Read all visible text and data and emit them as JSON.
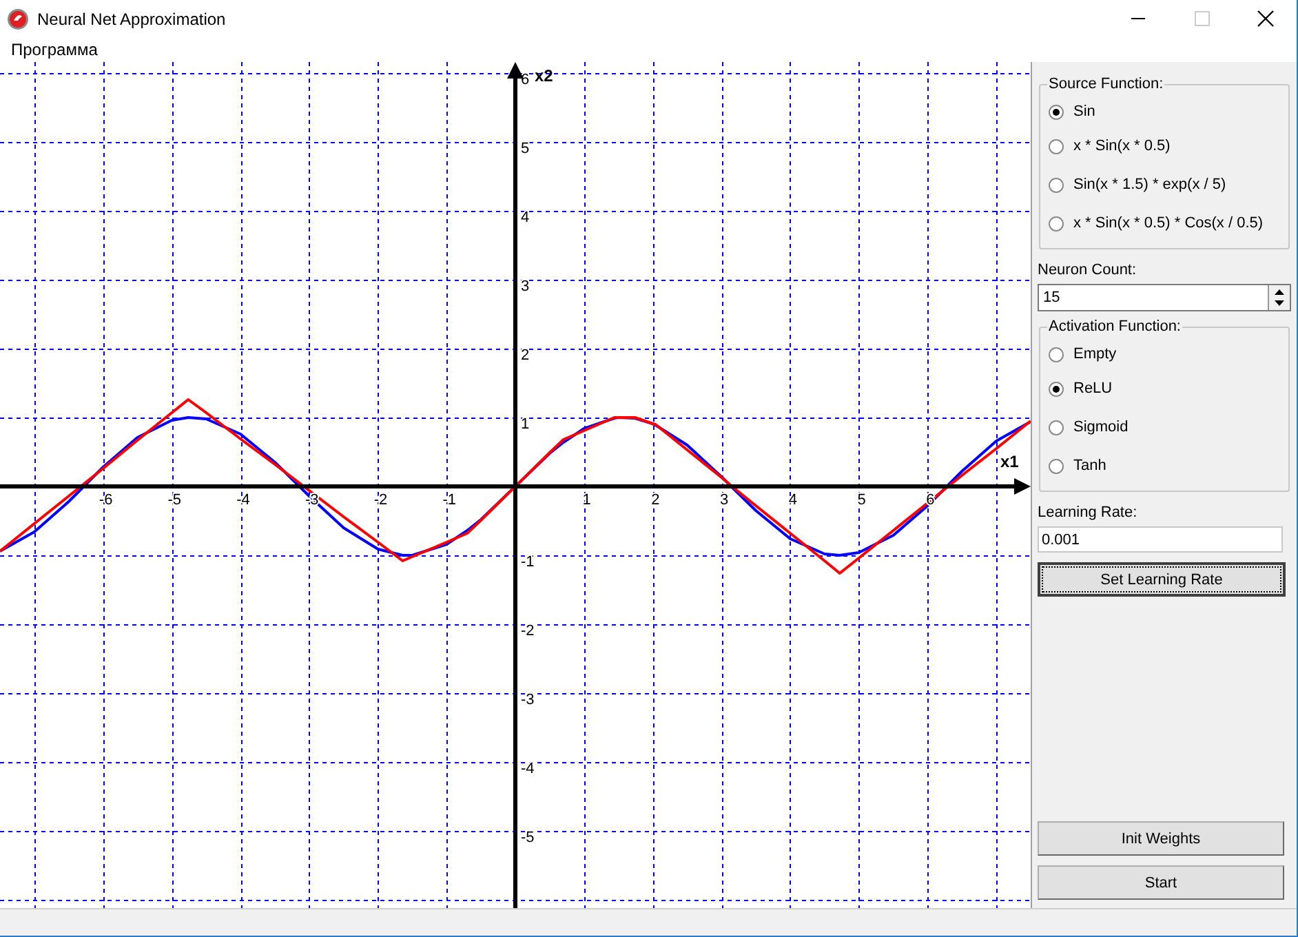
{
  "window": {
    "title": "Neural Net Approximation"
  },
  "menu": [
    {
      "label": "Программа"
    }
  ],
  "plot": {
    "chart_data": {
      "type": "line",
      "xlabel": "x1",
      "ylabel": "x2",
      "grid": true,
      "xlim": [
        -7.5,
        7.5
      ],
      "ylim": [
        -6.14,
        6.16
      ],
      "xticks": [
        -6,
        -5,
        -4,
        -3,
        -2,
        -1,
        1,
        2,
        3,
        4,
        5,
        6
      ],
      "yticks": [
        -5,
        -4,
        -3,
        -2,
        -1,
        1,
        2,
        3,
        4,
        5,
        6
      ],
      "x": [
        -7.5,
        -7,
        -6.5,
        -6,
        -5.5,
        -5,
        -4.76,
        -4.5,
        -4,
        -3.5,
        -3,
        -2.5,
        -2,
        -1.64,
        -1.5,
        -1,
        -0.7,
        -0.5,
        0,
        0.5,
        0.7,
        1,
        1.44,
        1.5,
        1.74,
        2,
        2.04,
        2.5,
        3,
        3.14,
        3.5,
        4,
        4.5,
        4.72,
        5,
        5.5,
        6,
        6.5,
        7,
        7.5
      ],
      "series": [
        {
          "color": "#0000ff",
          "values": [
            -0.94,
            -0.66,
            -0.22,
            0.28,
            0.71,
            0.96,
            1.0,
            0.98,
            0.76,
            0.35,
            -0.14,
            -0.6,
            -0.91,
            -1.0,
            -1.0,
            -0.84,
            -0.64,
            -0.48,
            0,
            0.48,
            0.64,
            0.84,
            0.99,
            1.0,
            0.99,
            0.91,
            0.89,
            0.6,
            0.14,
            0.0,
            -0.35,
            -0.76,
            -0.98,
            -1.0,
            -0.96,
            -0.71,
            -0.28,
            0.22,
            0.66,
            0.94
          ]
        },
        {
          "color": "#ff0000",
          "values": [
            -0.94,
            -0.54,
            -0.14,
            0.26,
            0.67,
            1.07,
            1.26,
            1.07,
            0.69,
            0.32,
            -0.06,
            -0.44,
            -0.81,
            -1.08,
            -1.02,
            -0.81,
            -0.68,
            -0.49,
            0,
            0.49,
            0.68,
            0.81,
            1.0,
            1.0,
            1.0,
            0.91,
            0.9,
            0.53,
            0.13,
            0.01,
            -0.28,
            -0.68,
            -1.08,
            -1.26,
            -1.04,
            -0.64,
            -0.24,
            0.16,
            0.55,
            0.95
          ]
        }
      ]
    }
  },
  "source_function": {
    "title": "Source Function:",
    "options": [
      {
        "label": "Sin",
        "selected": true
      },
      {
        "label": "x * Sin(x * 0.5)",
        "selected": false
      },
      {
        "label": "Sin(x * 1.5) * exp(x / 5)",
        "selected": false
      },
      {
        "label": "x * Sin(x * 0.5) * Cos(x / 0.5)",
        "selected": false
      }
    ]
  },
  "neuron_count": {
    "label": "Neuron Count:",
    "value": "15"
  },
  "activation_function": {
    "title": "Activation Function:",
    "options": [
      {
        "label": "Empty",
        "selected": false
      },
      {
        "label": "ReLU",
        "selected": true
      },
      {
        "label": "Sigmoid",
        "selected": false
      },
      {
        "label": "Tanh",
        "selected": false
      }
    ]
  },
  "learning_rate": {
    "label": "Learning Rate:",
    "value": "0.001",
    "button": {
      "label": "Set Learning Rate",
      "focused": true
    }
  },
  "buttons": [
    {
      "label": "Init Weights",
      "focused": false
    },
    {
      "label": "Start",
      "focused": false
    }
  ]
}
